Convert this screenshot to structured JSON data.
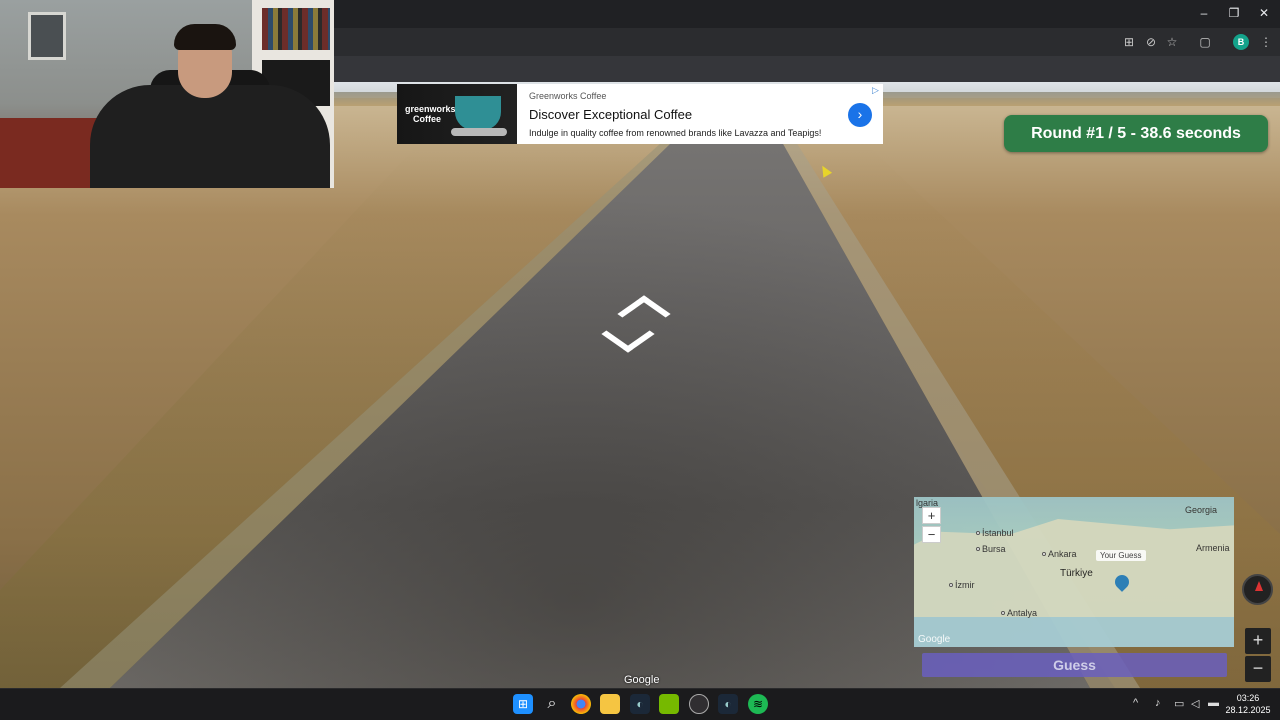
{
  "browser": {
    "window_controls": {
      "minimize": "–",
      "restore": "❐",
      "close": "✕"
    },
    "toolbar_icons": [
      "translate-icon",
      "eye-off-icon",
      "star-icon",
      "extensions-icon",
      "profile-avatar",
      "more-icon"
    ],
    "profile_initial": "B"
  },
  "ad": {
    "brand": "Greenworks Coffee",
    "title": "Discover Exceptional Coffee",
    "description": "Indulge in quality coffee from renowned brands like Lavazza and Teapigs!",
    "logo_text": "greenworks Coffee",
    "cta_icon": "›"
  },
  "game": {
    "round_status": "Round #1 / 5 - 38.6 seconds",
    "guess_label": "Guess",
    "map_tooltip": "Your Guess",
    "google_watermark": "Google",
    "map_google": "Google"
  },
  "map": {
    "labels": [
      {
        "text": "lgaria",
        "cls": ""
      },
      {
        "text": "Georgia",
        "cls": ""
      },
      {
        "text": "İstanbul",
        "cls": ""
      },
      {
        "text": "Bursa",
        "cls": ""
      },
      {
        "text": "Ankara",
        "cls": ""
      },
      {
        "text": "Armenia",
        "cls": ""
      },
      {
        "text": "Türkiye",
        "cls": "big"
      },
      {
        "text": "İzmir",
        "cls": ""
      },
      {
        "text": "Antalya",
        "cls": ""
      }
    ],
    "zoom_in": "+",
    "zoom_out": "−"
  },
  "streetview": {
    "zoom_in": "+",
    "zoom_out": "−"
  },
  "taskbar": {
    "apps": [
      "windows-start-icon",
      "search-icon",
      "chrome-icon",
      "file-explorer-icon",
      "steam-icon",
      "nvidia-icon",
      "obs-icon",
      "steam-icon-2",
      "spotify-icon"
    ],
    "tray_chevron": "^",
    "time": "03:26",
    "date": "28.12.2025"
  }
}
